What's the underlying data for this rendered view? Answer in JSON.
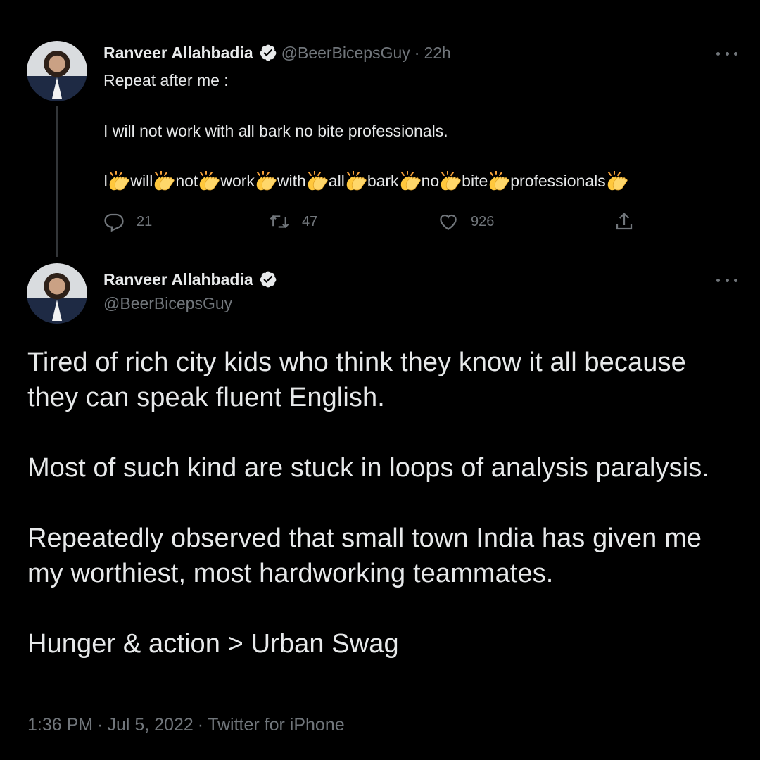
{
  "reply_tweet": {
    "author_name": "Ranveer Allahbadia",
    "author_handle": "@BeerBicepsGuy",
    "separator": "·",
    "time_ago": "22h",
    "verified": true,
    "line1": "Repeat after me :",
    "line2": "I will not work with all bark no bite professionals.",
    "clap_line": {
      "lead": "I",
      "words": [
        "will",
        "not",
        "work",
        "with",
        "all",
        "bark",
        "no",
        "bite",
        "professionals"
      ],
      "emoji": "clapping-hands"
    },
    "actions": {
      "replies": "21",
      "retweets": "47",
      "likes": "926"
    }
  },
  "main_tweet": {
    "author_name": "Ranveer Allahbadia",
    "author_handle": "@BeerBicepsGuy",
    "verified": true,
    "paragraphs": [
      "Tired of rich city kids who think they know it all because they can speak fluent English.",
      "Most of such kind are stuck in loops of analysis paralysis.",
      "Repeatedly observed that small town India has given me my worthiest, most hardworking teammates.",
      "Hunger & action > Urban Swag"
    ],
    "time": "1:36 PM",
    "date": "Jul 5, 2022",
    "source": "Twitter for iPhone",
    "separator": "·"
  },
  "colors": {
    "background": "#000000",
    "text": "#e7e9ea",
    "secondary": "#71767b",
    "thread_line": "#333639"
  },
  "icons": [
    "verified-badge-icon",
    "more-icon",
    "reply-icon",
    "retweet-icon",
    "like-icon",
    "share-icon",
    "clapping-hands-icon"
  ]
}
